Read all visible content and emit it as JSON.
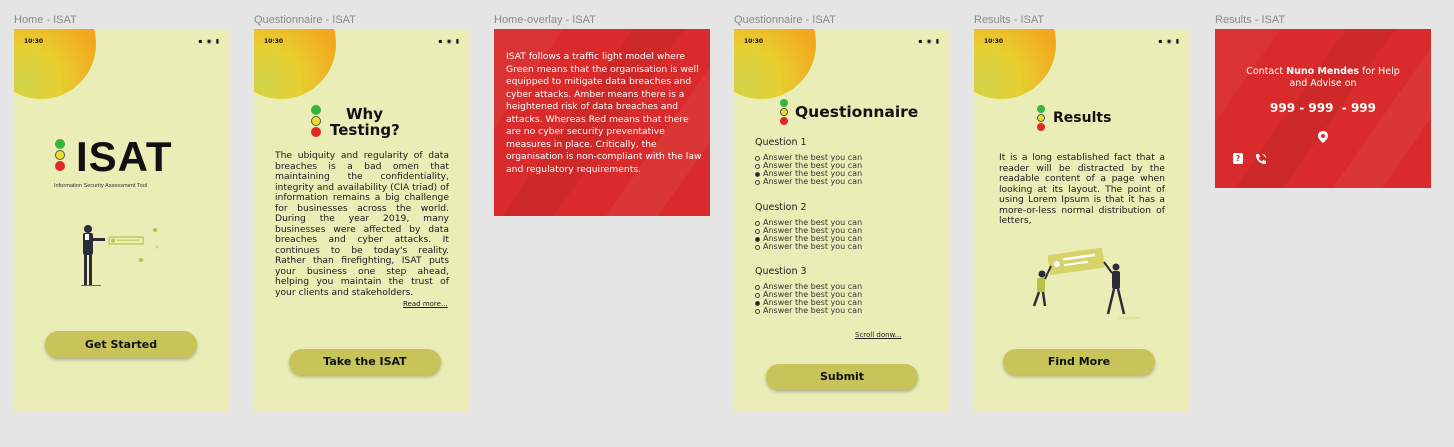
{
  "frames": {
    "home": {
      "label": "Home - ISAT",
      "status_time": "10:30",
      "status_icons": "▪︎ ◉ ▮",
      "logo_text": "ISAT",
      "subtitle": "Information Security Assessment Tool",
      "button": "Get Started"
    },
    "why": {
      "label": "Questionnaire - ISAT",
      "status_time": "10:30",
      "status_icons": "▪︎ ◉ ▮",
      "heading_line1": "Why",
      "heading_line2": "Testing?",
      "body": "The ubiquity and regularity of data breaches is a bad omen that maintaining the confidentiality, integrity and availability (CIA triad) of information remains a big challenge for businesses across the world. During the year 2019, many businesses were affected by data breaches and cyber attacks. It continues to be today's reality. Rather than firefighting, ISAT puts your business one step ahead, helping you maintain the trust of your clients and stakeholders.",
      "read_more": "Read more...",
      "button": "Take the ISAT"
    },
    "overlay": {
      "label": "Home-overlay - ISAT",
      "text": "ISAT follows a traffic light model where Green means that the organisation is well equipped to mitigate data breaches and cyber attacks. Amber means there is a heightened risk of data breaches and attacks. Whereas Red means that there are no cyber security preventative measures in place. Critically, the organisation is non-compliant with the law and regulatory requirements."
    },
    "questionnaire": {
      "label": "Questionnaire - ISAT",
      "status_time": "10:30",
      "status_icons": "▪︎ ◉ ▮",
      "heading": "Questionnaire",
      "questions": [
        {
          "title": "Question 1",
          "options": [
            "Answer the best you can",
            "Answer the best you can",
            "Answer the best you can",
            "Answer the best you can"
          ],
          "selected": 2
        },
        {
          "title": "Question 2",
          "options": [
            "Answer the best you can",
            "Answer the best you can",
            "Answer the best you can",
            "Answer the best you can"
          ],
          "selected": 2
        },
        {
          "title": "Question 3",
          "options": [
            "Answer the best you can",
            "Answer the best you can",
            "Answer the best you can",
            "Answer the best you can"
          ],
          "selected": 2
        }
      ],
      "scroll_link": "Scroll donw...",
      "button": "Submit"
    },
    "results": {
      "label": "Results - ISAT",
      "status_time": "10:30",
      "status_icons": "▪︎ ◉ ▮",
      "heading": "Results",
      "body": "It is a long established fact that a reader will be distracted by the readable content of a page when looking at its layout. The point of using Lorem Ipsum is that it has a more-or-less normal distribution of letters,",
      "button": "Find More"
    },
    "contact": {
      "label": "Results - ISAT",
      "line_prefix": "Contact ",
      "name": "Nuno Mendes",
      "line_suffix": " for Help",
      "line2": "and Advise on",
      "phone": "999 - 999  - 999"
    }
  },
  "colors": {
    "canvas": "#e5e5e5",
    "phone_bg": "#eaedb6",
    "button": "#c7c55a",
    "red_panel": "#d92b2b"
  }
}
